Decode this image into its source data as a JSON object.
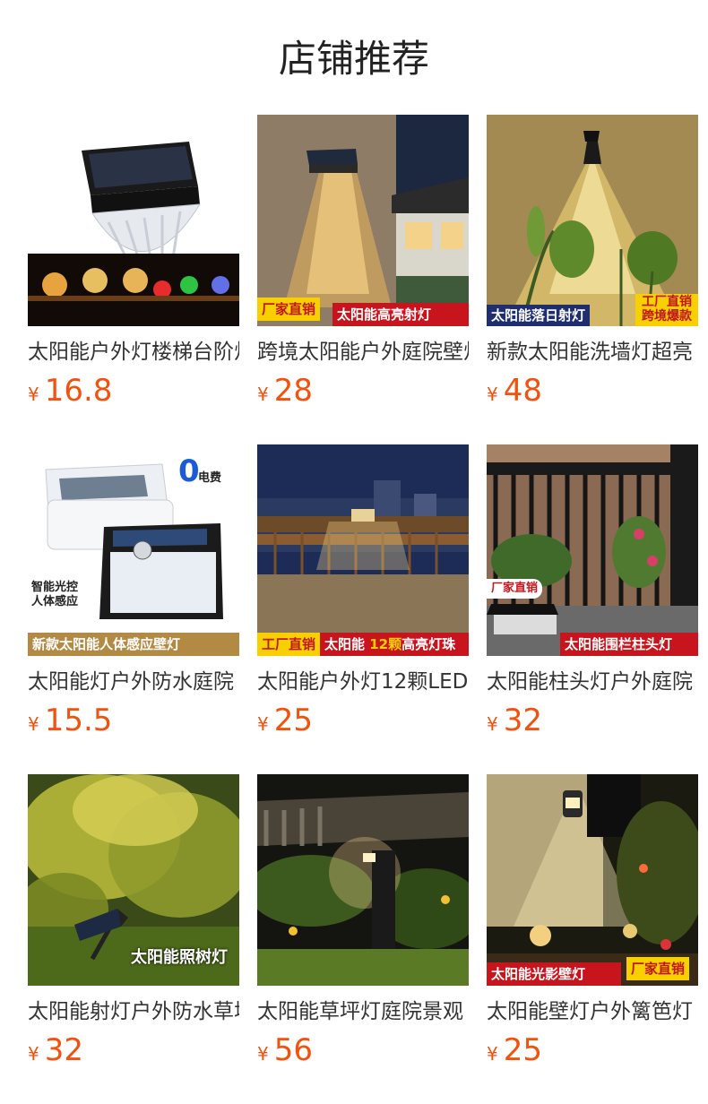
{
  "page": {
    "title": "店铺推荐"
  },
  "colors": {
    "price": "#f2520d",
    "tag_red": "#c8141c",
    "tag_yellow": "#f8d000",
    "tag_blue": "#1f2e6e",
    "tag_olive": "#b38a44"
  },
  "products": [
    {
      "name": "太阳能户外灯楼梯台阶灯",
      "currency": "¥",
      "price": "16.8",
      "image": "solar-step-light"
    },
    {
      "name": "跨境太阳能户外庭院壁灯",
      "currency": "¥",
      "price": "28",
      "image": "solar-wall-light-house",
      "tags": [
        "厂家直销",
        "太阳能高亮射灯"
      ]
    },
    {
      "name": "新款太阳能洗墙灯超亮",
      "currency": "¥",
      "price": "48",
      "image": "solar-spot-wall-washer",
      "tags": [
        "太阳能落日射灯",
        "工厂直销",
        "跨境爆款"
      ]
    },
    {
      "name": "太阳能灯户外防水庭院",
      "currency": "¥",
      "price": "15.5",
      "image": "solar-motion-sensor-light",
      "tags": [
        "新款太阳能人体感应壁灯",
        "智能光控",
        "人体感应",
        "0",
        "电费"
      ]
    },
    {
      "name": "太阳能户外灯12颗LED",
      "currency": "¥",
      "price": "25",
      "image": "solar-fence-light-balcony",
      "tags": [
        "工厂直销",
        "太阳能",
        "12颗",
        "高亮灯珠"
      ]
    },
    {
      "name": "太阳能柱头灯户外庭院",
      "currency": "¥",
      "price": "32",
      "image": "solar-post-cap-light",
      "tags": [
        "厂家直销",
        "太阳能围栏柱头灯"
      ]
    },
    {
      "name": "太阳能射灯户外防水草坪",
      "currency": "¥",
      "price": "32",
      "image": "solar-tree-spotlight",
      "tags": [
        "太阳能照树灯"
      ]
    },
    {
      "name": "太阳能草坪灯庭院景观",
      "currency": "¥",
      "price": "56",
      "image": "solar-lawn-light"
    },
    {
      "name": "太阳能壁灯户外篱笆灯",
      "currency": "¥",
      "price": "25",
      "image": "solar-shadow-wall-light",
      "tags": [
        "太阳能光影壁灯",
        "厂家直销"
      ]
    }
  ]
}
